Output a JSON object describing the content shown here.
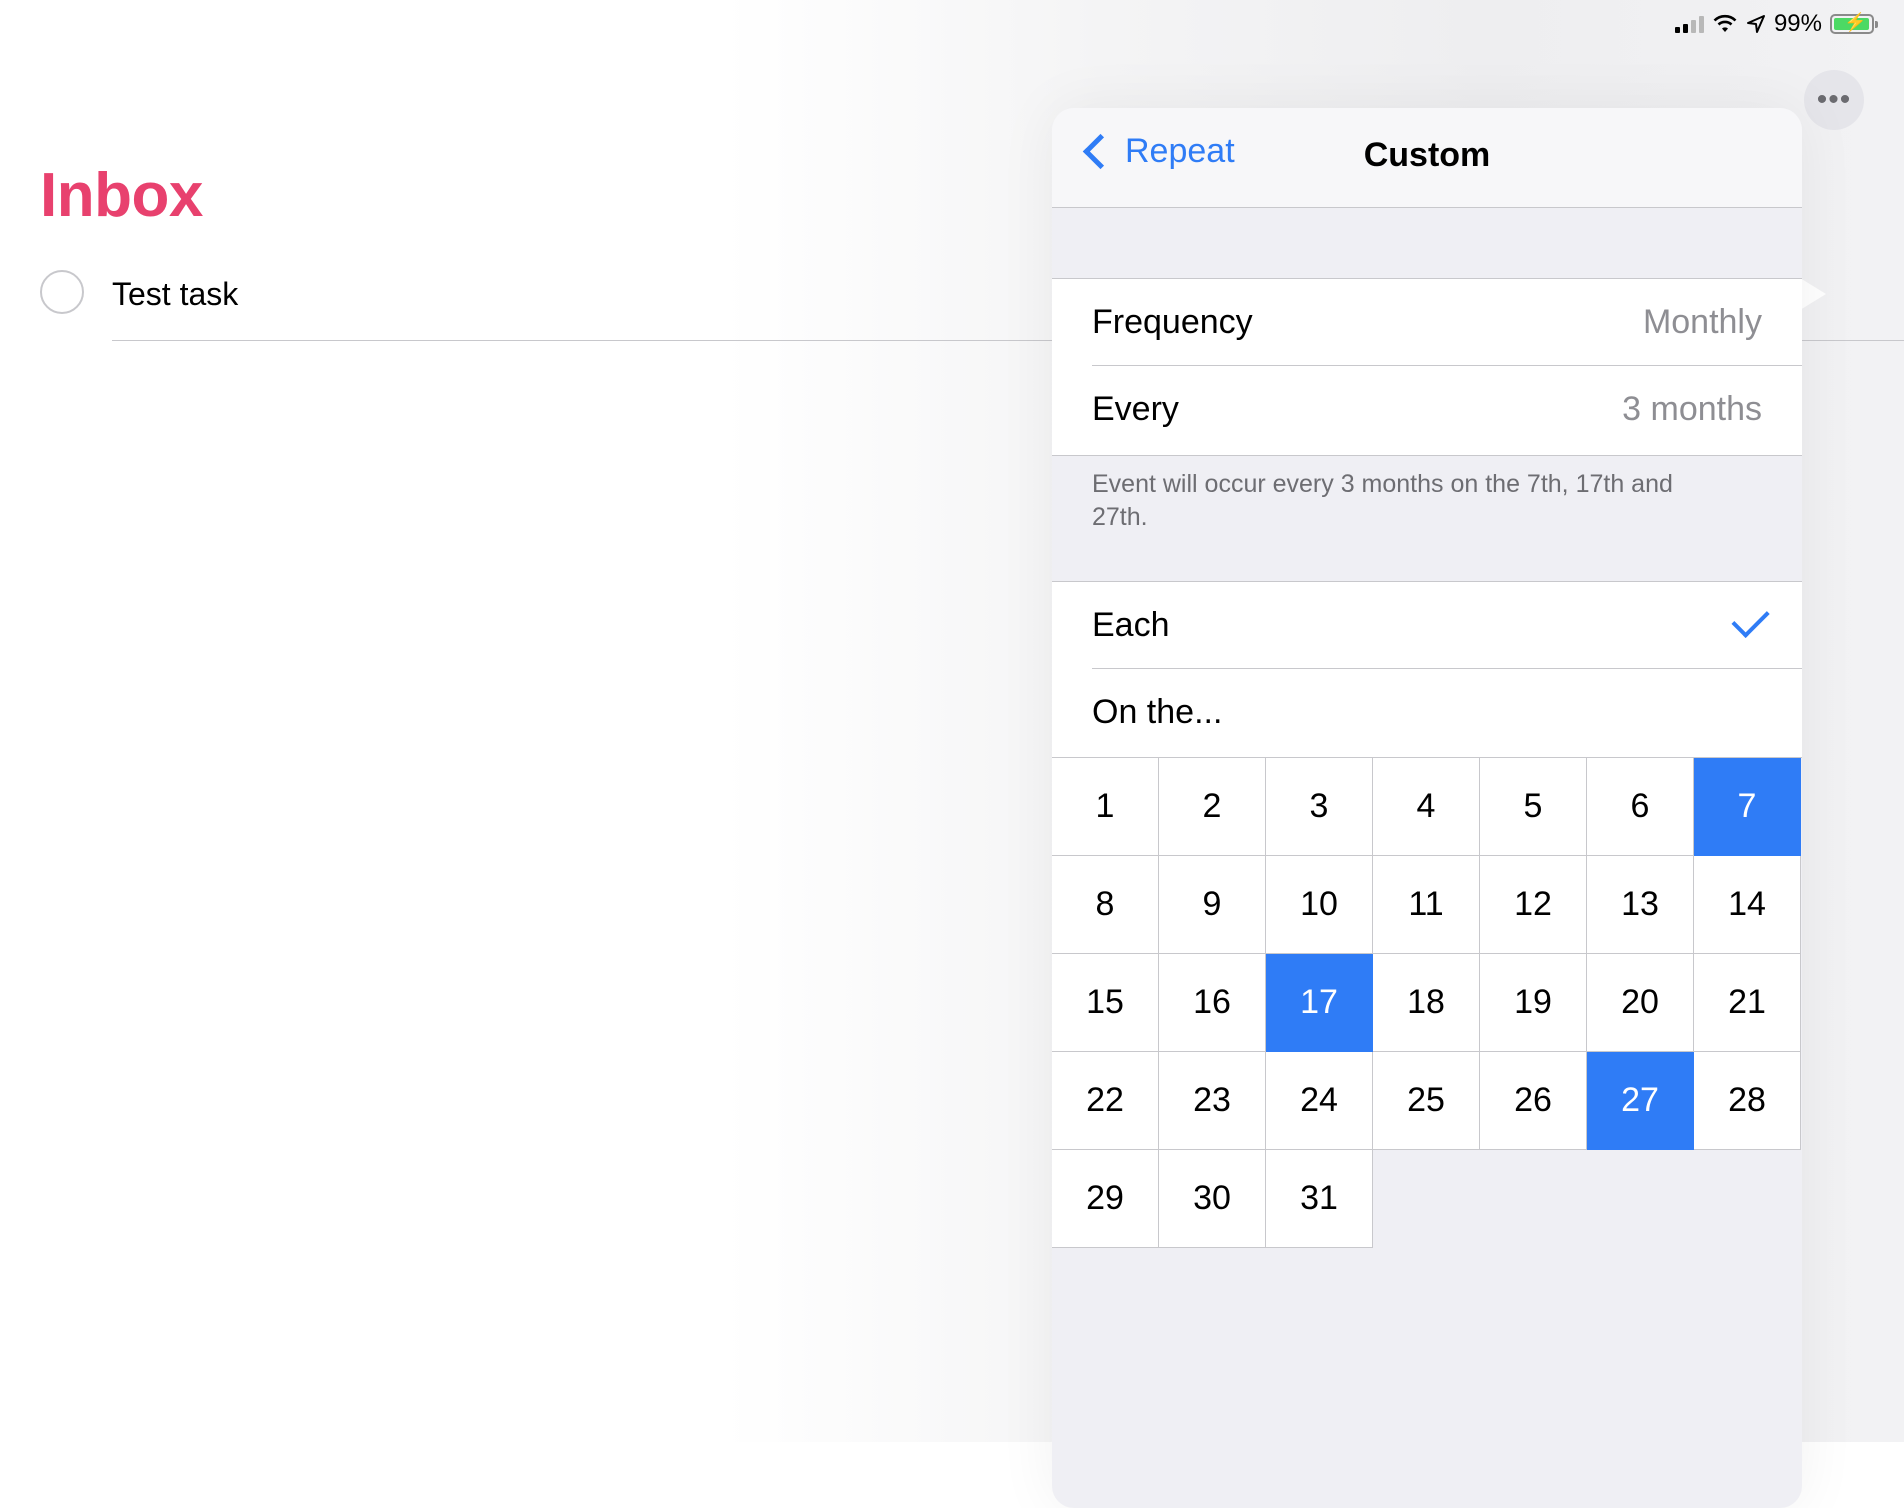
{
  "status_bar": {
    "battery_percent": "99%",
    "battery_level": 0.99,
    "icons": [
      "signal-icon",
      "wifi-icon",
      "location-arrow-icon",
      "battery-charging-icon"
    ]
  },
  "list": {
    "title": "Inbox",
    "tasks": [
      {
        "label": "Test task",
        "completed": false
      }
    ]
  },
  "more_button": {
    "icon": "ellipsis-icon",
    "glyph": "•••"
  },
  "popover": {
    "back_label": "Repeat",
    "title": "Custom",
    "frequency_label": "Frequency",
    "frequency_value": "Monthly",
    "every_label": "Every",
    "every_value": "3 months",
    "footnote": "Event will occur every 3 months on the 7th, 17th and 27th.",
    "each_label": "Each",
    "each_selected": true,
    "on_the_label": "On the...",
    "days": [
      "1",
      "2",
      "3",
      "4",
      "5",
      "6",
      "7",
      "8",
      "9",
      "10",
      "11",
      "12",
      "13",
      "14",
      "15",
      "16",
      "17",
      "18",
      "19",
      "20",
      "21",
      "22",
      "23",
      "24",
      "25",
      "26",
      "27",
      "28",
      "29",
      "30",
      "31"
    ],
    "selected_days": [
      "7",
      "17",
      "27"
    ]
  },
  "colors": {
    "accent": "#2f7cf6",
    "inbox_title": "#e8416e",
    "secondary_text": "#8e8e93",
    "grouped_background": "#efeff4"
  }
}
